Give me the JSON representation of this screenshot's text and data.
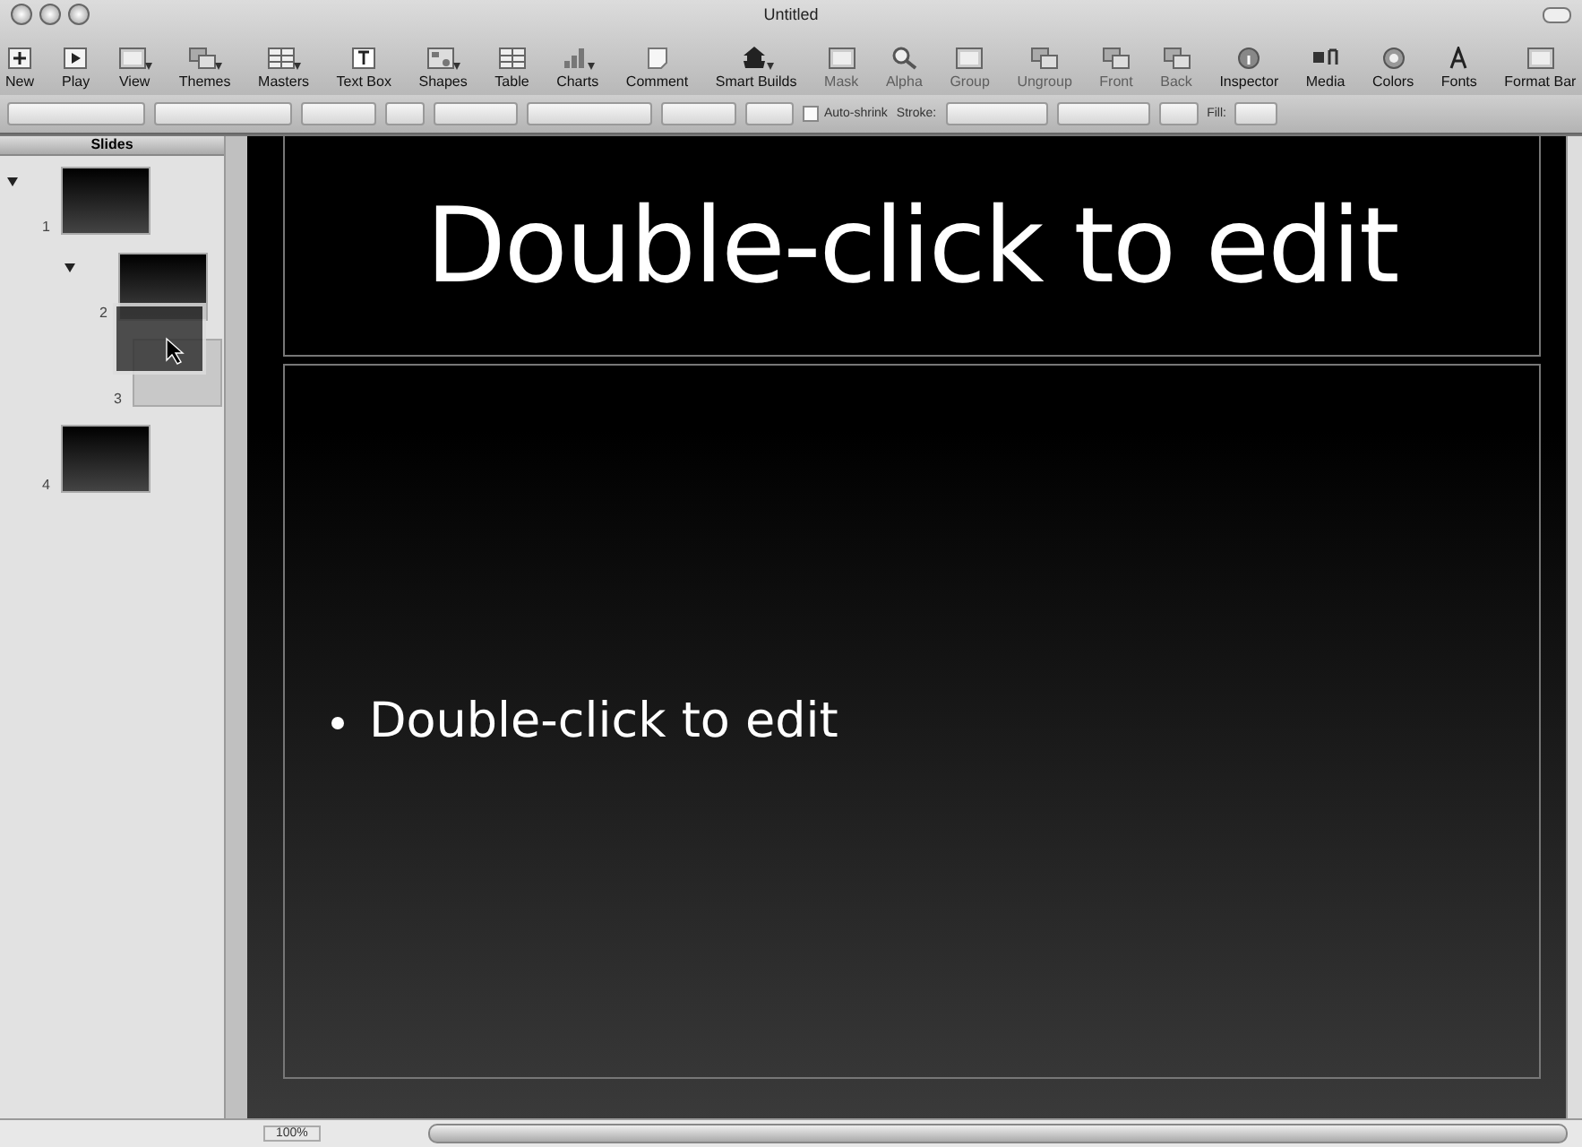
{
  "window": {
    "title": "Untitled"
  },
  "toolbar": [
    {
      "label": "New",
      "kind": "plus",
      "disabled": false,
      "menu": false
    },
    {
      "label": "Play",
      "kind": "play",
      "disabled": false,
      "menu": false
    },
    {
      "label": "View",
      "kind": "window",
      "disabled": false,
      "menu": true
    },
    {
      "label": "Themes",
      "kind": "stack",
      "disabled": false,
      "menu": true
    },
    {
      "label": "Masters",
      "kind": "grid",
      "disabled": false,
      "menu": true
    },
    {
      "label": "Text Box",
      "kind": "textbox",
      "disabled": false,
      "menu": false
    },
    {
      "label": "Shapes",
      "kind": "shapes",
      "disabled": false,
      "menu": true
    },
    {
      "label": "Table",
      "kind": "grid",
      "disabled": false,
      "menu": false
    },
    {
      "label": "Charts",
      "kind": "chart",
      "disabled": false,
      "menu": true
    },
    {
      "label": "Comment",
      "kind": "note",
      "disabled": false,
      "menu": false
    },
    {
      "label": "Smart Builds",
      "kind": "pagoda",
      "disabled": false,
      "menu": true
    },
    {
      "label": "Mask",
      "kind": "window",
      "disabled": true,
      "menu": false
    },
    {
      "label": "Alpha",
      "kind": "magnifier",
      "disabled": true,
      "menu": false
    },
    {
      "label": "Group",
      "kind": "window",
      "disabled": true,
      "menu": false
    },
    {
      "label": "Ungroup",
      "kind": "stack",
      "disabled": true,
      "menu": false
    },
    {
      "label": "Front",
      "kind": "stack",
      "disabled": true,
      "menu": false
    },
    {
      "label": "Back",
      "kind": "stack",
      "disabled": true,
      "menu": false
    },
    {
      "label": "Inspector",
      "kind": "info",
      "disabled": false,
      "menu": false
    },
    {
      "label": "Media",
      "kind": "media",
      "disabled": false,
      "menu": false
    },
    {
      "label": "Colors",
      "kind": "circle",
      "disabled": false,
      "menu": false
    },
    {
      "label": "Fonts",
      "kind": "letter",
      "disabled": false,
      "menu": false
    },
    {
      "label": "Format Bar",
      "kind": "window",
      "disabled": false,
      "menu": false
    }
  ],
  "format_bar": {
    "auto_shrink": {
      "label": "Auto-shrink",
      "checked": false
    },
    "stroke_label": "Stroke:",
    "fill_label": "Fill:"
  },
  "sidebar": {
    "title": "Slides",
    "slides": [
      {
        "number": "1",
        "expanded": true,
        "kind": "slide"
      },
      {
        "number": "2",
        "expanded": true,
        "kind": "slide"
      },
      {
        "number": "3",
        "expanded": false,
        "kind": "placeholder"
      },
      {
        "number": "4",
        "expanded": false,
        "kind": "slide"
      }
    ]
  },
  "slide": {
    "title": "Double-click to edit",
    "bullets": [
      "Double-click to edit"
    ]
  },
  "status_bar": {
    "zoom": "100%"
  }
}
